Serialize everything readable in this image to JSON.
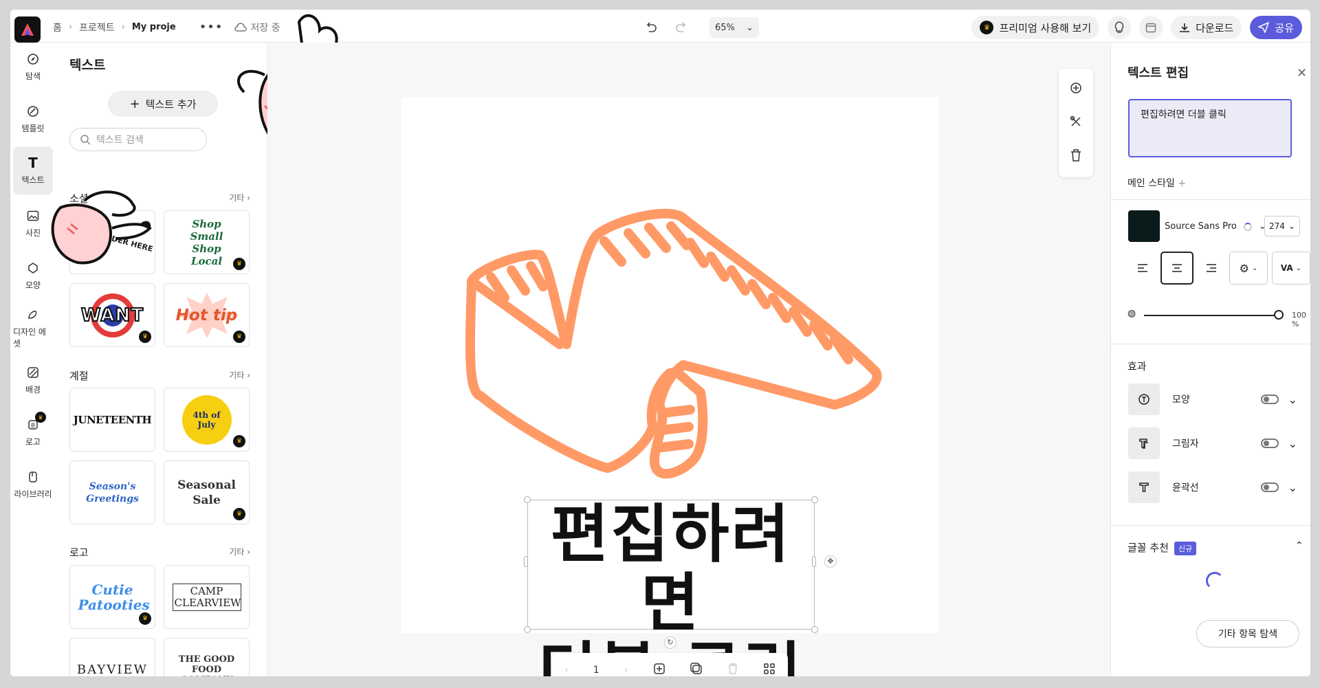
{
  "topbar": {
    "breadcrumbs": [
      "홈",
      "프로젝트",
      "My proje"
    ],
    "save_status": "저장 중",
    "zoom": "65%",
    "premium_label": "프리미엄 사용해 보기",
    "download_label": "다운로드",
    "share_label": "공유"
  },
  "rail": {
    "items": [
      "탐색",
      "템플릿",
      "텍스트",
      "사진",
      "모양",
      "디자인 에셋",
      "배경",
      "로고",
      "라이브러리"
    ]
  },
  "panel": {
    "title": "텍스트",
    "add_text": "텍스트 추가",
    "search_placeholder": "텍스트 검색",
    "more": "기타",
    "sections": [
      {
        "title": "소셜",
        "tiles": [
          "ORDER HERE",
          "Shop Small Shop Local",
          "WANT",
          "Hot tip"
        ]
      },
      {
        "title": "계절",
        "tiles": [
          "JUNETEENTH",
          "4th of July",
          "Season's Greetings",
          "Seasonal Sale"
        ]
      },
      {
        "title": "로고",
        "tiles": [
          "Cutie Patooties",
          "CAMP CLEARVIEW",
          "BAYVIEW",
          "THE GOOD FOOD COMPANY"
        ]
      }
    ]
  },
  "canvas": {
    "text_line1": "편집하려면",
    "text_line2": "더블 클릭",
    "page_number": "1"
  },
  "right_panel": {
    "title": "텍스트 편집",
    "textarea_value": "편집하려면 더블 클릭",
    "main_style": "메인 스타일",
    "font_name": "Source Sans Pro",
    "font_size": "274",
    "opacity": "100 %",
    "effects_title": "효과",
    "effects": [
      "모양",
      "그림자",
      "윤곽선"
    ],
    "font_recommend": "글꼴 추천",
    "new_badge": "신규",
    "explore_more": "기타 항목 탐색"
  },
  "colors": {
    "accent": "#5b5bdc",
    "text_color": "#0b1a1a",
    "graphic": "#ff9a66"
  }
}
